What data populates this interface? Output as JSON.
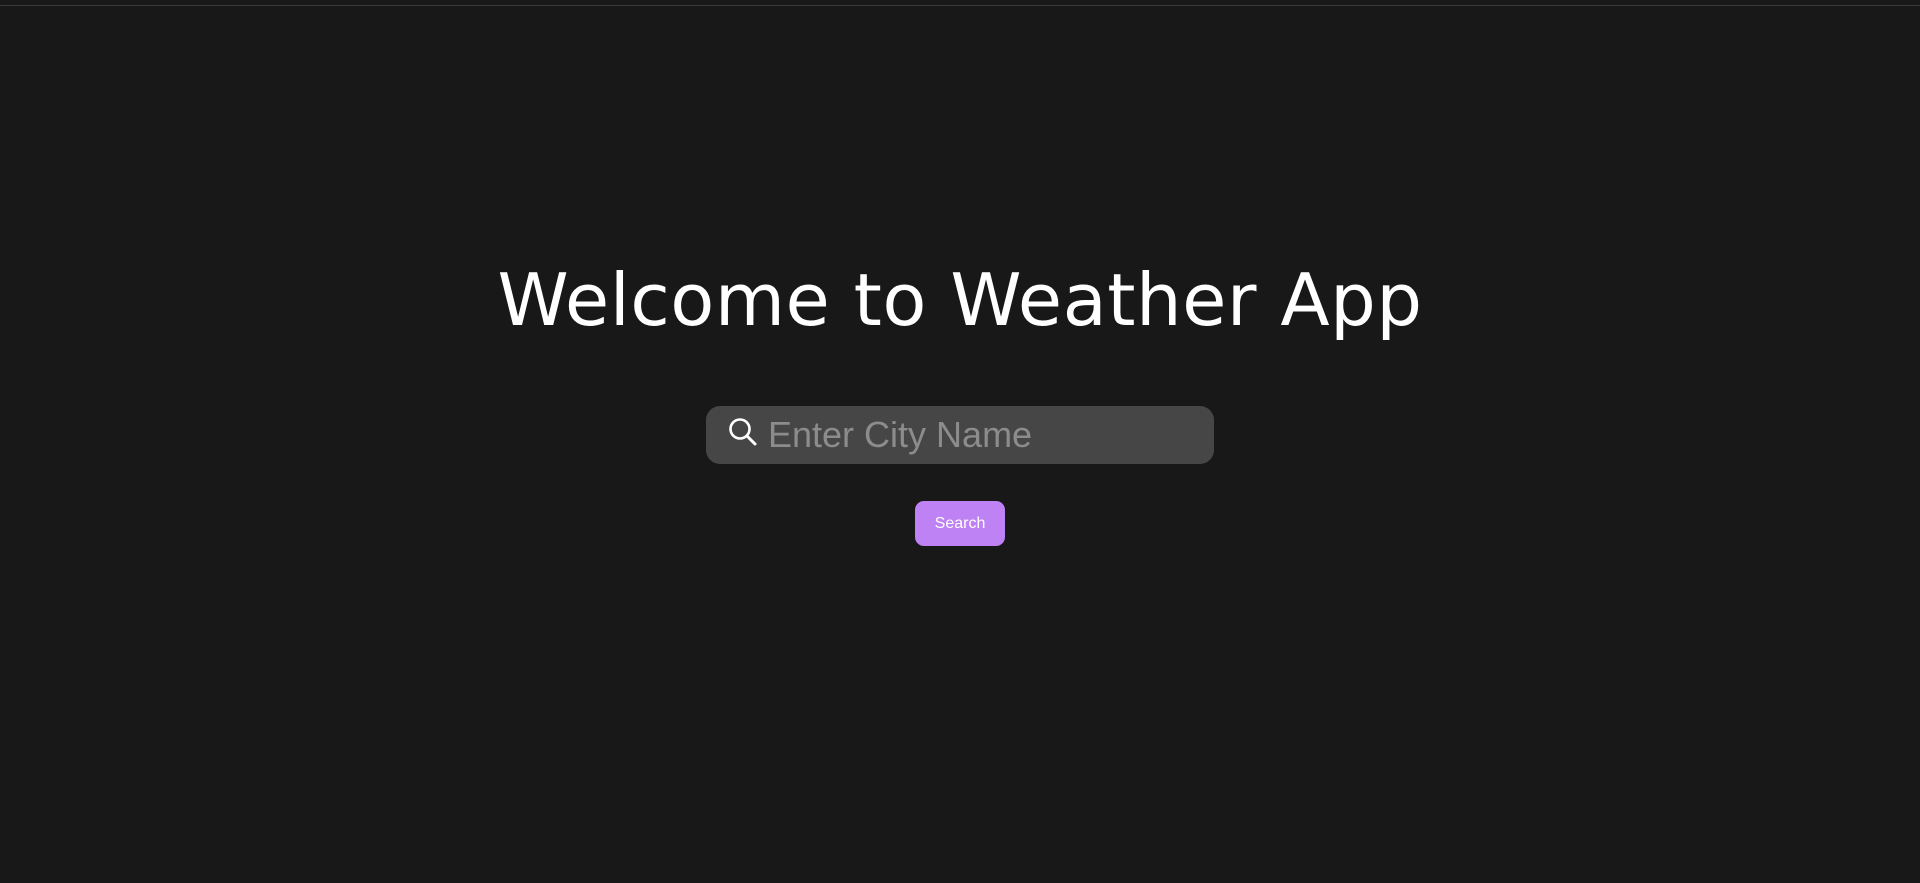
{
  "page": {
    "title": "Welcome to Weather App"
  },
  "search": {
    "icon": "search-icon",
    "placeholder": "Enter City Name",
    "value": "",
    "button_label": "Search"
  },
  "colors": {
    "background": "#181818",
    "input_background": "#464646",
    "accent": "#bf82f5",
    "placeholder": "#8c8c8c",
    "text": "#ffffff"
  }
}
